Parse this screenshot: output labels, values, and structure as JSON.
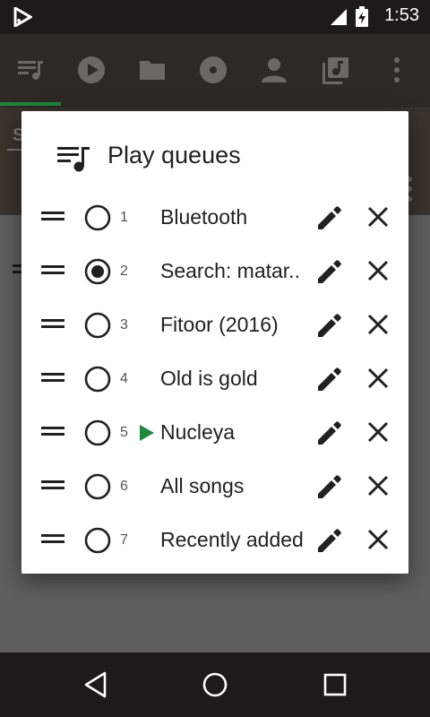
{
  "status_bar": {
    "time": "1:53"
  },
  "dialog": {
    "title": "Play queues",
    "queues": [
      {
        "number": "1",
        "name": "Bluetooth",
        "selected": false,
        "playing": false
      },
      {
        "number": "2",
        "name": "Search: matar..",
        "selected": true,
        "playing": false
      },
      {
        "number": "3",
        "name": "Fitoor (2016)",
        "selected": false,
        "playing": false
      },
      {
        "number": "4",
        "name": "Old is gold",
        "selected": false,
        "playing": false
      },
      {
        "number": "5",
        "name": "Nucleya",
        "selected": false,
        "playing": true
      },
      {
        "number": "6",
        "name": "All songs",
        "selected": false,
        "playing": false
      },
      {
        "number": "7",
        "name": "Recently added",
        "selected": false,
        "playing": false
      }
    ]
  },
  "behind": {
    "search_hint": "S"
  },
  "colors": {
    "accent": "#1b8a3a",
    "status_bar": "#1e1a17",
    "toolbar_dimmed": "#2f2925",
    "scrim": "#5e5e5e"
  },
  "icons": {
    "toolbar": [
      "queue-music-icon",
      "play-circle-icon",
      "folder-icon",
      "album-icon",
      "person-icon",
      "playlist-icon",
      "more-vert-icon"
    ],
    "nav": [
      "back-icon",
      "home-icon",
      "recents-icon"
    ]
  }
}
